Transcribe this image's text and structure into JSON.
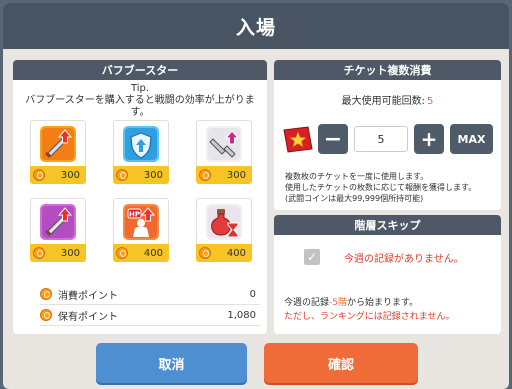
{
  "dialog": {
    "title": "入場"
  },
  "buff_panel": {
    "title": "バフブースター",
    "tip_label": "Tip.",
    "tip_text": "バフブースターを購入すると戦闘の効率が上がります。",
    "items": [
      {
        "icon": "sword-attack-up-icon",
        "price": "300"
      },
      {
        "icon": "shield-defense-up-icon",
        "price": "300"
      },
      {
        "icon": "broken-sword-icon",
        "price": "300"
      },
      {
        "icon": "sword-critical-up-icon",
        "price": "300"
      },
      {
        "icon": "hp-up-icon",
        "price": "400"
      },
      {
        "icon": "potion-hourglass-icon",
        "price": "400"
      }
    ],
    "points": [
      {
        "label": "消費ポイント",
        "value": "0"
      },
      {
        "label": "保有ポイント",
        "value": "1,080"
      }
    ]
  },
  "ticket_panel": {
    "title": "チケット複数消費",
    "max_label": "最大使用可能回数:",
    "max_value": "5",
    "count": "5",
    "minus": "−",
    "plus": "+",
    "max_button": "MAX",
    "desc_lines": [
      "複数枚のチケットを一度に使用します。",
      "使用したチケットの枚数に応じて報酬を獲得します。",
      "(武闘コインは最大99,999個所持可能)"
    ]
  },
  "skip_panel": {
    "title": "階層スキップ",
    "check_mark": "✓",
    "status": "今週の記録がありません。",
    "note_pre": "今週の記録",
    "note_floor": "-5階",
    "note_post": "から始まります。",
    "warning": "ただし、ランキングには記録されません。"
  },
  "buttons": {
    "cancel": "取消",
    "confirm": "確認"
  },
  "colors": {
    "header": "#4a5563",
    "accent_orange": "#ef6b38",
    "accent_blue": "#4d8fd1",
    "price_bar": "#f7c425",
    "warning": "#e23b2e"
  }
}
